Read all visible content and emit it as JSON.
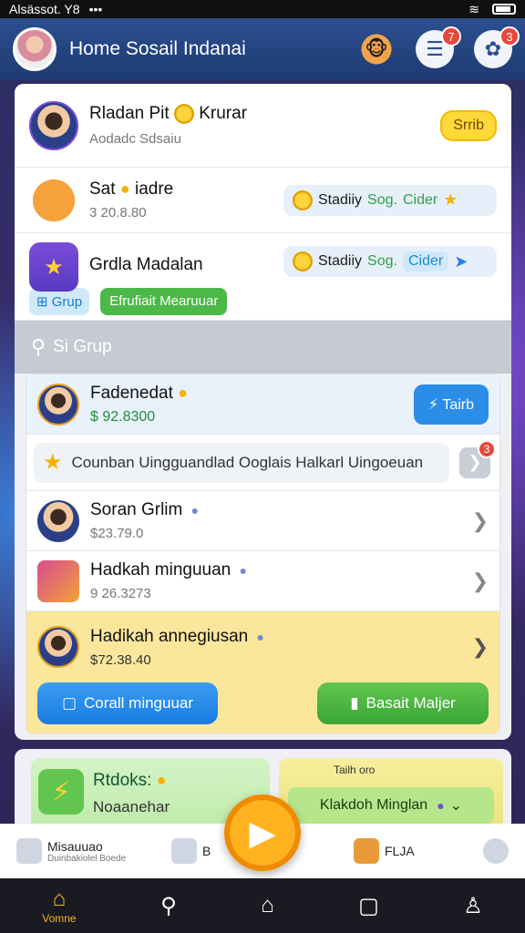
{
  "status_bar": {
    "left_text": "Alsässot. Y8",
    "dots": "•••"
  },
  "header": {
    "title": "Home Sosail Indanai",
    "badge_notifications": "7",
    "badge_alerts": "3"
  },
  "top_card": {
    "profile": {
      "name": "Rladan Pit",
      "tag": "Krurar",
      "subtitle": "Aodadc Sdsaiu",
      "button": "Srrib"
    },
    "row2": {
      "name": "Sat",
      "tag": "iadre",
      "value": "3 20.8.80",
      "pill_label": "Stadiiy",
      "pill_green": "Sog.",
      "pill_cyan": "Cider"
    },
    "row3": {
      "name": "Grdla Madalan",
      "pill_label": "Stadiiy",
      "pill_green": "Sog.",
      "pill_cyan": "Cider",
      "chip_blue": "Grup",
      "chip_green": "Efrufiait Mearuuar"
    }
  },
  "search": {
    "label": "Si Grup"
  },
  "list": {
    "featured": {
      "name": "Fadenedat",
      "price": "$ 92.8300",
      "button": "Tairb"
    },
    "notice": {
      "text": "Counban Uingguandlad Ooglais Halkarl Uingoeuan",
      "badge": "3"
    },
    "items": [
      {
        "name": "Soran Grlim",
        "value": "$23.79.0"
      },
      {
        "name": "Hadkah minguuan",
        "value": "9 26.3273"
      }
    ],
    "highlight": {
      "name": "Hadikah annegiusan",
      "value": "$72.38.40",
      "btn_left": "Corall minguuar",
      "btn_right": "Basait  Maljer"
    }
  },
  "promo": {
    "left_title": "Rtdoks:",
    "left_sub": "Noaanehar",
    "right_mini": "Tailh     oro",
    "right_btn": "Klakdoh Minglan"
  },
  "game_bar": {
    "item1": "Misauuao",
    "item1_sub": "Duinbakiolel Boede",
    "item2": "B",
    "item3": "FLJA"
  },
  "nav": {
    "home_label": "Vomne"
  },
  "colors": {
    "header_blue": "#2c4f8f",
    "accent_yellow": "#ffd93a",
    "accent_green": "#4cb847",
    "accent_blue": "#2a8ee8",
    "badge_red": "#e8473c"
  },
  "icons": [
    "search-icon",
    "chat-icon",
    "settings-icon",
    "coin-icon",
    "star-icon",
    "chevron-right-icon",
    "play-icon",
    "home-icon",
    "back-icon",
    "square-icon"
  ]
}
